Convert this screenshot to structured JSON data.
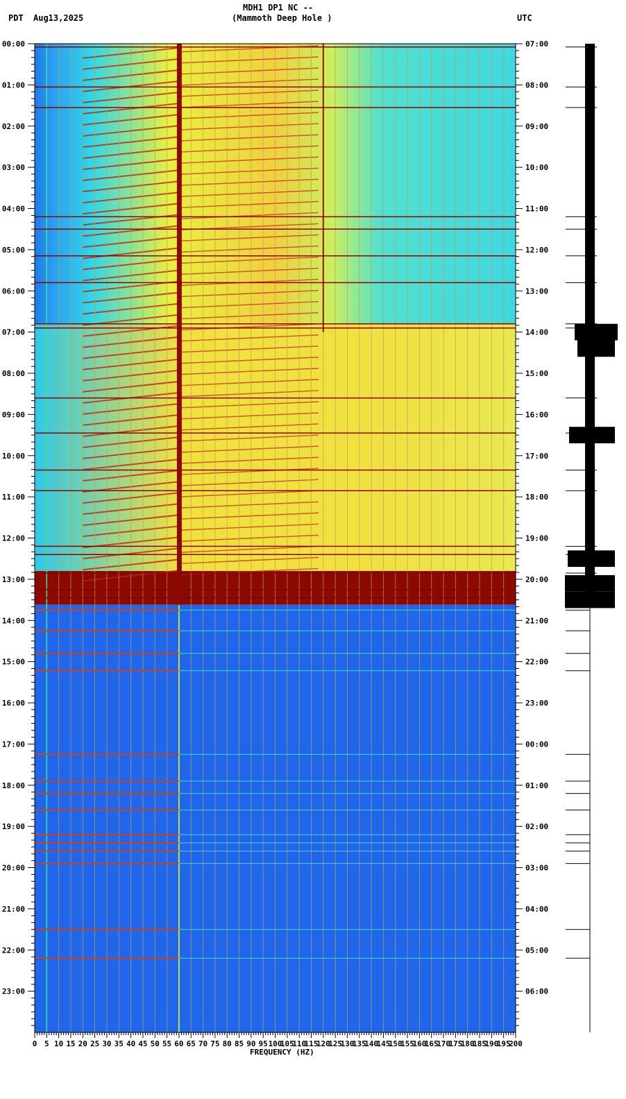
{
  "header": {
    "station": "MDH1 DP1 NC --",
    "site": "(Mammoth Deep Hole )",
    "left_tz": "PDT",
    "date": "Aug13,2025",
    "right_tz": "UTC"
  },
  "chart_data": {
    "type": "heatmap",
    "title": "MDH1 DP1 NC -- (Mammoth Deep Hole )",
    "xlabel": "FREQUENCY (HZ)",
    "ylabel_left": "PDT",
    "ylabel_right": "UTC",
    "xlim": [
      0,
      200
    ],
    "x_ticks": [
      "0",
      "5",
      "10",
      "15",
      "20",
      "25",
      "30",
      "35",
      "40",
      "45",
      "50",
      "55",
      "60",
      "65",
      "70",
      "75",
      "80",
      "85",
      "90",
      "95",
      "100",
      "105",
      "110",
      "115",
      "120",
      "125",
      "130",
      "135",
      "140",
      "145",
      "150",
      "155",
      "160",
      "165",
      "170",
      "175",
      "180",
      "185",
      "190",
      "195",
      "200"
    ],
    "y_ticks_left": [
      "00:00",
      "01:00",
      "02:00",
      "03:00",
      "04:00",
      "05:00",
      "06:00",
      "07:00",
      "08:00",
      "09:00",
      "10:00",
      "11:00",
      "12:00",
      "13:00",
      "14:00",
      "15:00",
      "16:00",
      "17:00",
      "18:00",
      "19:00",
      "20:00",
      "21:00",
      "22:00",
      "23:00"
    ],
    "y_ticks_right": [
      "07:00",
      "08:00",
      "09:00",
      "10:00",
      "11:00",
      "12:00",
      "13:00",
      "14:00",
      "15:00",
      "16:00",
      "17:00",
      "18:00",
      "19:00",
      "20:00",
      "21:00",
      "22:00",
      "23:00",
      "00:00",
      "01:00",
      "02:00",
      "03:00",
      "04:00",
      "05:00",
      "06:00"
    ],
    "ylim_hours": [
      0,
      24
    ],
    "high_noise_period_hours": [
      0,
      13.62
    ],
    "persistent_lines_hz": [
      5,
      60,
      120
    ],
    "event_lines_hours": [
      0.08,
      1.05,
      1.55,
      4.2,
      4.5,
      5.15,
      5.8,
      6.8,
      6.9,
      8.6,
      9.45,
      10.35,
      10.85,
      12.2,
      12.4,
      12.85,
      13.25,
      13.45,
      13.75,
      14.25,
      14.8,
      15.22,
      17.25,
      17.9,
      18.2,
      18.6,
      19.2,
      19.4,
      19.6,
      19.9,
      21.5,
      22.2
    ],
    "colormap": [
      "#1a55e8",
      "#1e90ff",
      "#20e0e0",
      "#f0f040",
      "#f08020",
      "#e02010",
      "#800000"
    ]
  }
}
